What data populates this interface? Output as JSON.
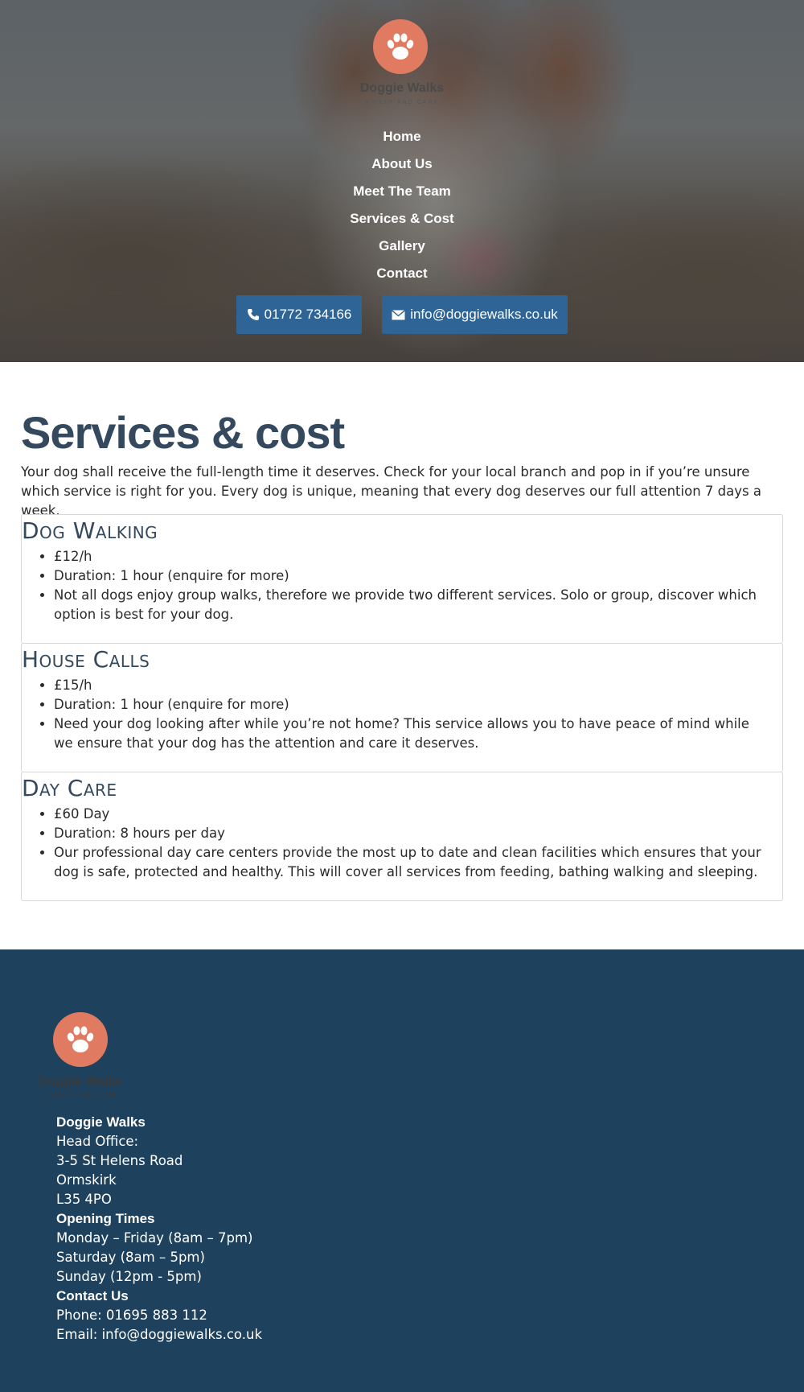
{
  "site": {
    "logo_name": "Doggie Walks",
    "logo_tagline": "A HELP AND CARE",
    "accent_color": "#e07b62",
    "icon": "paw-icon"
  },
  "nav": {
    "items": [
      "Home",
      "About Us",
      "Meet The Team",
      "Services & Cost",
      "Gallery",
      "Contact"
    ]
  },
  "header_contacts": {
    "phone": "01772 734166",
    "email": "info@doggiewalks.co.uk",
    "button_color": "#2e6496"
  },
  "main": {
    "title": "Services & cost",
    "intro": "Your dog shall receive the full-length time it deserves. Check for your local branch and pop in if you’re unsure which service is right for you. Every dog is unique, meaning that every dog deserves our full attention 7 days a week.",
    "services": [
      {
        "title": "Dog Walking",
        "price": "£12/h",
        "duration": "Duration: 1 hour (enquire for more)",
        "description": "Not all dogs enjoy group walks, therefore we provide two different services. Solo or group, discover which option is best for your dog."
      },
      {
        "title": "House Calls",
        "price": "£15/h",
        "duration": "Duration: 1 hour (enquire for more)",
        "description": "Need your dog looking after while you’re not home? This service allows you to have peace of mind while we ensure that your dog has the attention and care it deserves."
      },
      {
        "title": "Day Care",
        "price": "£60 Day",
        "duration": "Duration: 8 hours per day",
        "description": "Our professional day care centers provide the most up to date and clean facilities which ensures that your dog is safe, protected and healthy. This will cover all services from feeding, bathing walking and sleeping."
      }
    ]
  },
  "footer": {
    "background_color": "#1e425e",
    "company": "Doggie Walks",
    "office_label": "Head Office:",
    "address_line1": "3-5 St Helens Road",
    "address_line2": "Ormskirk",
    "postcode": "L35 4PO",
    "opening_heading": "Opening Times",
    "hours_weekday": "Monday – Friday (8am – 7pm)",
    "hours_saturday": "Saturday (8am – 5pm)",
    "hours_sunday": "Sunday (12pm - 5pm)",
    "contact_heading": "Contact Us",
    "phone": "Phone: 01695 883 112",
    "email": "Email: info@doggiewalks.co.uk"
  }
}
